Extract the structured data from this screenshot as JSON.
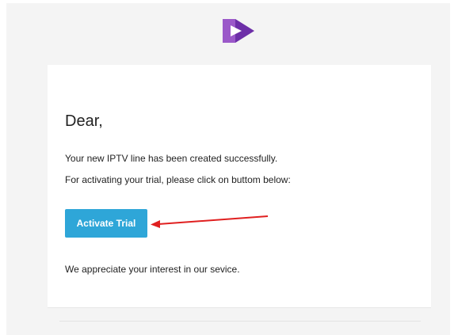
{
  "colors": {
    "page_background": "#f4f4f4",
    "card_background": "#ffffff",
    "button_background": "#2ea6d8",
    "button_text": "#ffffff",
    "arrow": "#e02020",
    "logo_left": "#9b59c9",
    "logo_right": "#6d2fa8"
  },
  "logo": {
    "icon": "play-logo-icon"
  },
  "email": {
    "greeting": "Dear,",
    "line1": "Your new IPTV line has been created successfully.",
    "line2": "For activating your trial, please click on buttom below:",
    "button_label": "Activate Trial",
    "closing": "We appreciate your interest in our sevice."
  },
  "annotation": {
    "icon": "red-arrow-icon"
  }
}
